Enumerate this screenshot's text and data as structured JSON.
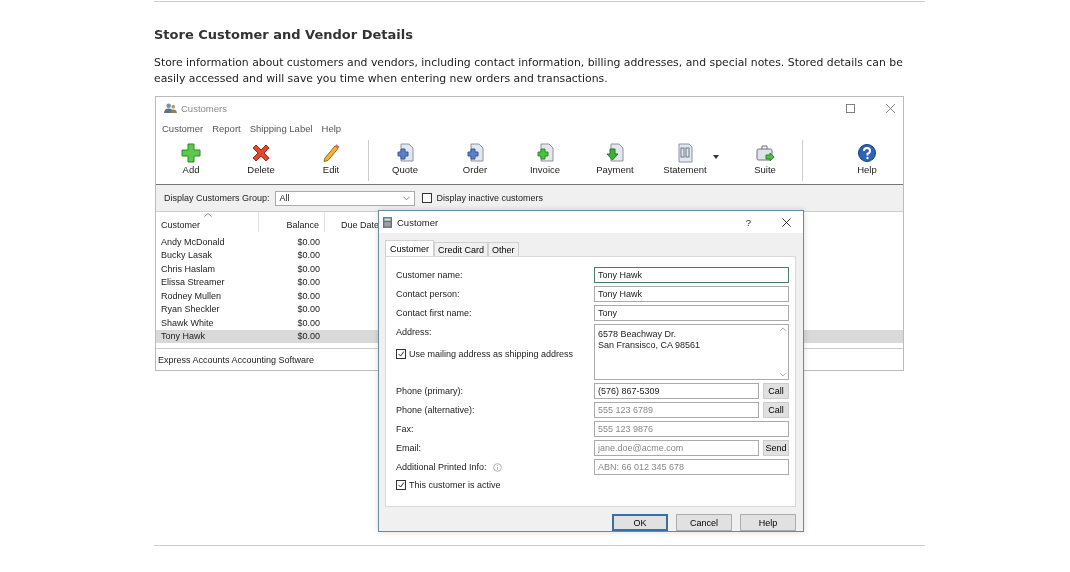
{
  "section": {
    "heading": "Store Customer and Vendor Details",
    "description": "Store information about customers and vendors, including contact information, billing addresses, and special notes. Stored details can be easily accessed and will save you time when entering new orders and transactions."
  },
  "app_window": {
    "title": "Customers",
    "menu": [
      "Customer",
      "Report",
      "Shipping Label",
      "Help"
    ],
    "toolbar": [
      [
        {
          "label": "Add",
          "has_menu": false
        },
        {
          "label": "Delete",
          "has_menu": false
        },
        {
          "label": "Edit",
          "has_menu": false
        }
      ],
      [
        {
          "label": "Quote",
          "has_menu": false
        },
        {
          "label": "Order",
          "has_menu": false
        },
        {
          "label": "Invoice",
          "has_menu": false
        },
        {
          "label": "Payment",
          "has_menu": false
        },
        {
          "label": "Statement",
          "has_menu": true
        },
        {
          "label": "Suite",
          "has_menu": false
        }
      ],
      [
        {
          "label": "Help",
          "has_menu": false
        }
      ]
    ],
    "filter": {
      "label": "Display Customers Group:",
      "value": "All",
      "checkbox": {
        "label": "Display inactive customers",
        "checked": false
      }
    },
    "table": {
      "columns": [
        "Customer",
        "Balance",
        "Due Date"
      ],
      "rows": [
        {
          "customer": "Andy McDonald",
          "balance": "$0.00",
          "selected": false
        },
        {
          "customer": "Bucky Lasak",
          "balance": "$0.00",
          "selected": false
        },
        {
          "customer": "Chris Haslam",
          "balance": "$0.00",
          "selected": false
        },
        {
          "customer": "Elissa Streamer",
          "balance": "$0.00",
          "selected": false
        },
        {
          "customer": "Rodney Mullen",
          "balance": "$0.00",
          "selected": false
        },
        {
          "customer": "Ryan Sheckler",
          "balance": "$0.00",
          "selected": false
        },
        {
          "customer": "Shawk White",
          "balance": "$0.00",
          "selected": false
        },
        {
          "customer": "Tony Hawk",
          "balance": "$0.00",
          "selected": true
        }
      ]
    },
    "status_bar": "Express Accounts Accounting Software"
  },
  "dialog": {
    "title": "Customer",
    "help": "?",
    "tabs": [
      {
        "label": "Customer",
        "selected": true
      },
      {
        "label": "Credit Card",
        "selected": false
      },
      {
        "label": "Other",
        "selected": false
      }
    ],
    "fields": [
      {
        "kind": "text",
        "label": "Customer name:",
        "value": "Tony Hawk",
        "focused": true,
        "info": false
      },
      {
        "kind": "text",
        "label": "Contact person:",
        "value": "Tony Hawk",
        "focused": false,
        "info": false
      },
      {
        "kind": "text",
        "label": "Contact first name:",
        "value": "Tony",
        "focused": false,
        "info": false
      },
      {
        "kind": "address",
        "label": "Address:",
        "value": "6578 Beachway Dr.\nSan Fransisco, CA 98561",
        "focused": false,
        "info": false,
        "checkbox": {
          "label": "Use mailing address as shipping address",
          "checked": true
        }
      },
      {
        "kind": "text",
        "label": "Phone (primary):",
        "value": "(576) 867-5309",
        "button": "Call",
        "focused": false,
        "info": false
      },
      {
        "kind": "text",
        "label": "Phone (alternative):",
        "placeholder": "555 123 6789",
        "button": "Call",
        "focused": false,
        "info": false
      },
      {
        "kind": "text",
        "label": "Fax:",
        "placeholder": "555 123 9876",
        "focused": false,
        "info": false
      },
      {
        "kind": "text",
        "label": "Email:",
        "placeholder": "jane.doe@acme.com",
        "button": "Send",
        "focused": false,
        "info": false
      },
      {
        "kind": "text",
        "label": "Additional Printed Info:",
        "placeholder": "ABN: 66 012 345 678",
        "focused": false,
        "info": true
      }
    ],
    "active": {
      "label": "This customer is active",
      "checked": true
    },
    "buttons": [
      {
        "label": "OK",
        "default": true
      },
      {
        "label": "Cancel",
        "default": false
      },
      {
        "label": "Help",
        "default": false
      }
    ]
  }
}
